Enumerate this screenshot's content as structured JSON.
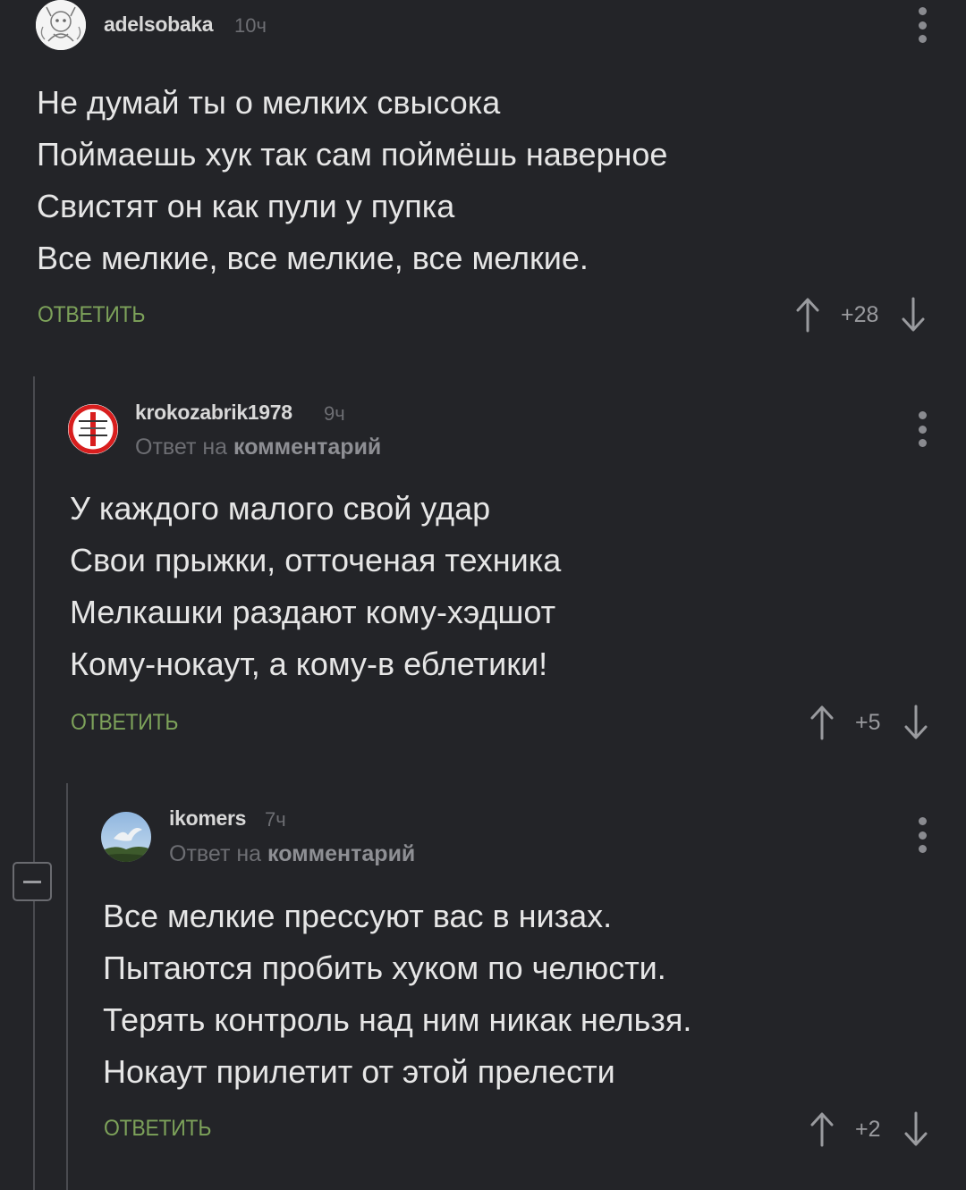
{
  "comments": [
    {
      "username": "adelsobaka",
      "time": "10ч",
      "reply_prefix": "",
      "reply_target": "",
      "lines": [
        "Не думай ты о мелких свысока",
        "Поймаешь хук так сам поймёшь наверное",
        "Свистят он как пули у пупка",
        "Все мелкие, все мелкие, все мелкие."
      ],
      "reply_label": "ОТВЕТИТЬ",
      "score": "+28"
    },
    {
      "username": "krokozabrik1978",
      "time": "9ч",
      "reply_prefix": "Ответ на",
      "reply_target": "комментарий",
      "lines": [
        "У каждого малого свой удар",
        "Свои прыжки, отточеная техника",
        "Мелкашки раздают кому-хэдшот",
        "Кому-нокаут, а кому-в еблетики!"
      ],
      "reply_label": "ОТВЕТИТЬ",
      "score": "+5"
    },
    {
      "username": "ikomers",
      "time": "7ч",
      "reply_prefix": "Ответ на",
      "reply_target": "комментарий",
      "lines": [
        "Все мелкие прессуют вас в низах.",
        "Пытаются пробить хуком по челюсти.",
        "Терять контроль над ним никак нельзя.",
        "Нокаут прилетит от этой прелести"
      ],
      "reply_label": "ОТВЕТИТЬ",
      "score": "+2"
    }
  ],
  "colors": {
    "background": "#232428",
    "reply_accent": "#7da25a",
    "thread_line": "#4a4b50"
  },
  "icons": [
    "more-vert-icon",
    "arrow-up-icon",
    "arrow-down-icon",
    "collapse-minus-icon"
  ]
}
